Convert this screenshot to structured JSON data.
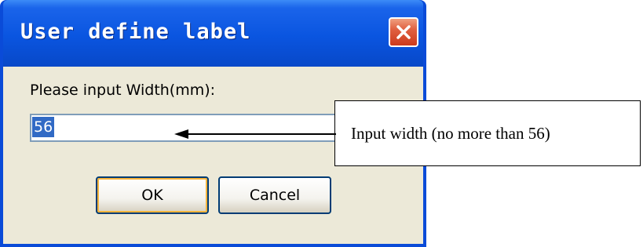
{
  "dialog": {
    "title": "User define label",
    "prompt": "Please input Width(mm):",
    "input_value": "56",
    "ok_label": "OK",
    "cancel_label": "Cancel"
  },
  "annotation": {
    "text": "Input width (no more than 56)"
  },
  "icons": {
    "close": "close-icon",
    "arrow": "arrow-left-icon"
  },
  "colors": {
    "titlebar": "#0a55e0",
    "close_button": "#e06040",
    "dialog_face": "#ece9d8",
    "selection": "#316ac5"
  }
}
